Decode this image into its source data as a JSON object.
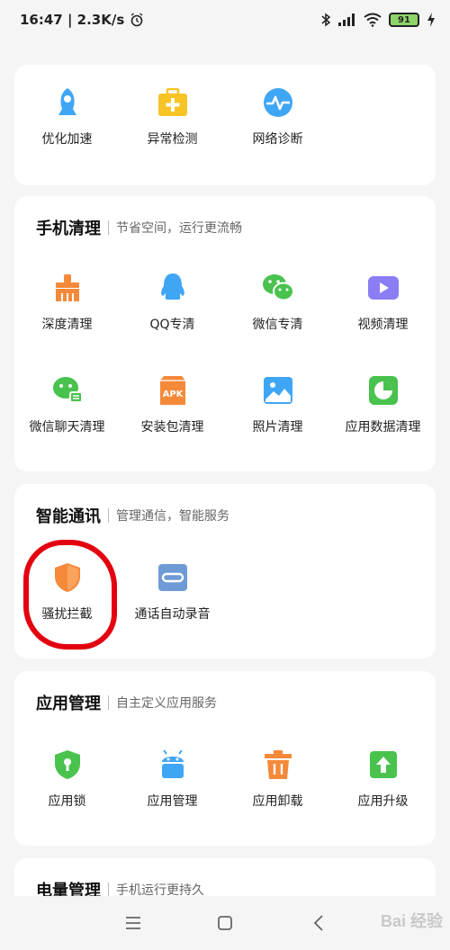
{
  "status": {
    "time_speed": "16:47 | 2.3K/s",
    "battery": "91"
  },
  "top_tools": [
    {
      "label": "优化加速",
      "icon": "rocket-icon",
      "color": "#3fa6f5"
    },
    {
      "label": "异常检测",
      "icon": "medical-kit-icon",
      "color": "#f7c325"
    },
    {
      "label": "网络诊断",
      "icon": "pulse-icon",
      "color": "#3fa6f5"
    }
  ],
  "phone_clean": {
    "title": "手机清理",
    "subtitle": "节省空间，运行更流畅",
    "items": [
      {
        "label": "深度清理",
        "icon": "broom-icon",
        "color": "#f5893a"
      },
      {
        "label": "QQ专清",
        "icon": "qq-penguin-icon",
        "color": "#3fa6f5"
      },
      {
        "label": "微信专清",
        "icon": "wechat-icon",
        "color": "#49c24e"
      },
      {
        "label": "视频清理",
        "icon": "video-icon",
        "color": "#8b7df3"
      },
      {
        "label": "微信聊天清理",
        "icon": "wechat-chat-icon",
        "color": "#49c24e"
      },
      {
        "label": "安装包清理",
        "icon": "apk-icon",
        "color": "#f5893a"
      },
      {
        "label": "照片清理",
        "icon": "photo-icon",
        "color": "#3fa6f5"
      },
      {
        "label": "应用数据清理",
        "icon": "pie-chart-icon",
        "color": "#49c24e"
      }
    ]
  },
  "smart_comm": {
    "title": "智能通讯",
    "subtitle": "管理通信，智能服务",
    "items": [
      {
        "label": "骚扰拦截",
        "icon": "shield-icon",
        "color": "#f5893a"
      },
      {
        "label": "通话自动录音",
        "icon": "recording-icon",
        "color": "#6e9bd6"
      }
    ]
  },
  "app_manage": {
    "title": "应用管理",
    "subtitle": "自主定义应用服务",
    "items": [
      {
        "label": "应用锁",
        "icon": "lock-shield-icon",
        "color": "#49c24e"
      },
      {
        "label": "应用管理",
        "icon": "android-icon",
        "color": "#3fa6f5"
      },
      {
        "label": "应用卸载",
        "icon": "trash-icon",
        "color": "#f5893a"
      },
      {
        "label": "应用升级",
        "icon": "upgrade-arrow-icon",
        "color": "#49c24e"
      }
    ]
  },
  "battery_manage": {
    "title": "电量管理",
    "subtitle": "手机运行更持久"
  },
  "watermark": "Bai 经验"
}
